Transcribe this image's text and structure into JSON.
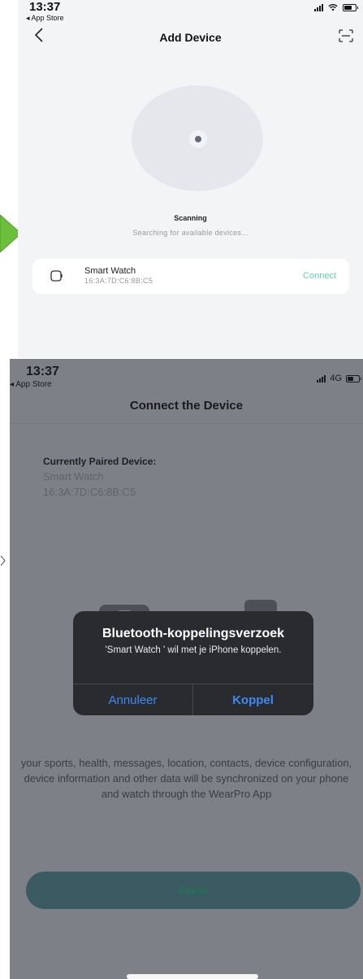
{
  "screen1": {
    "status": {
      "time": "13:37",
      "back_app": "◂ App Store"
    },
    "nav": {
      "title": "Add Device",
      "back_icon": "chevron-left-icon",
      "scan_icon": "scan-frame-icon"
    },
    "scan": {
      "heading": "Scanning",
      "subtext": "Searching for available devices..."
    },
    "device": {
      "name": "Smart Watch",
      "mac": "16:3A:7D:C6:8B:C5",
      "action": "Connect",
      "icon": "watch-icon"
    }
  },
  "screen2": {
    "status": {
      "time": "13:37",
      "back_app": "◂ App Store",
      "network": "4G"
    },
    "title": "Connect the Device",
    "paired": {
      "label": "Currently Paired Device:",
      "name": "Smart Watch",
      "mac": "16:3A:7D:C6:8B:C5"
    },
    "sync_text": "your sports, health, messages, location, contacts, device configuration, device information and other data will be synchronized on your phone and watch through the WearPro App",
    "finish": "Finish",
    "alert": {
      "title": "Bluetooth-koppelingsverzoek",
      "message": "'Smart Watch ' wil met je iPhone koppelen.",
      "cancel": "Annuleer",
      "confirm": "Koppel"
    }
  },
  "colors": {
    "accent_green": "#57d6a8",
    "ios_blue": "#3d8af7",
    "arrow_green": "#6cbf3a"
  }
}
